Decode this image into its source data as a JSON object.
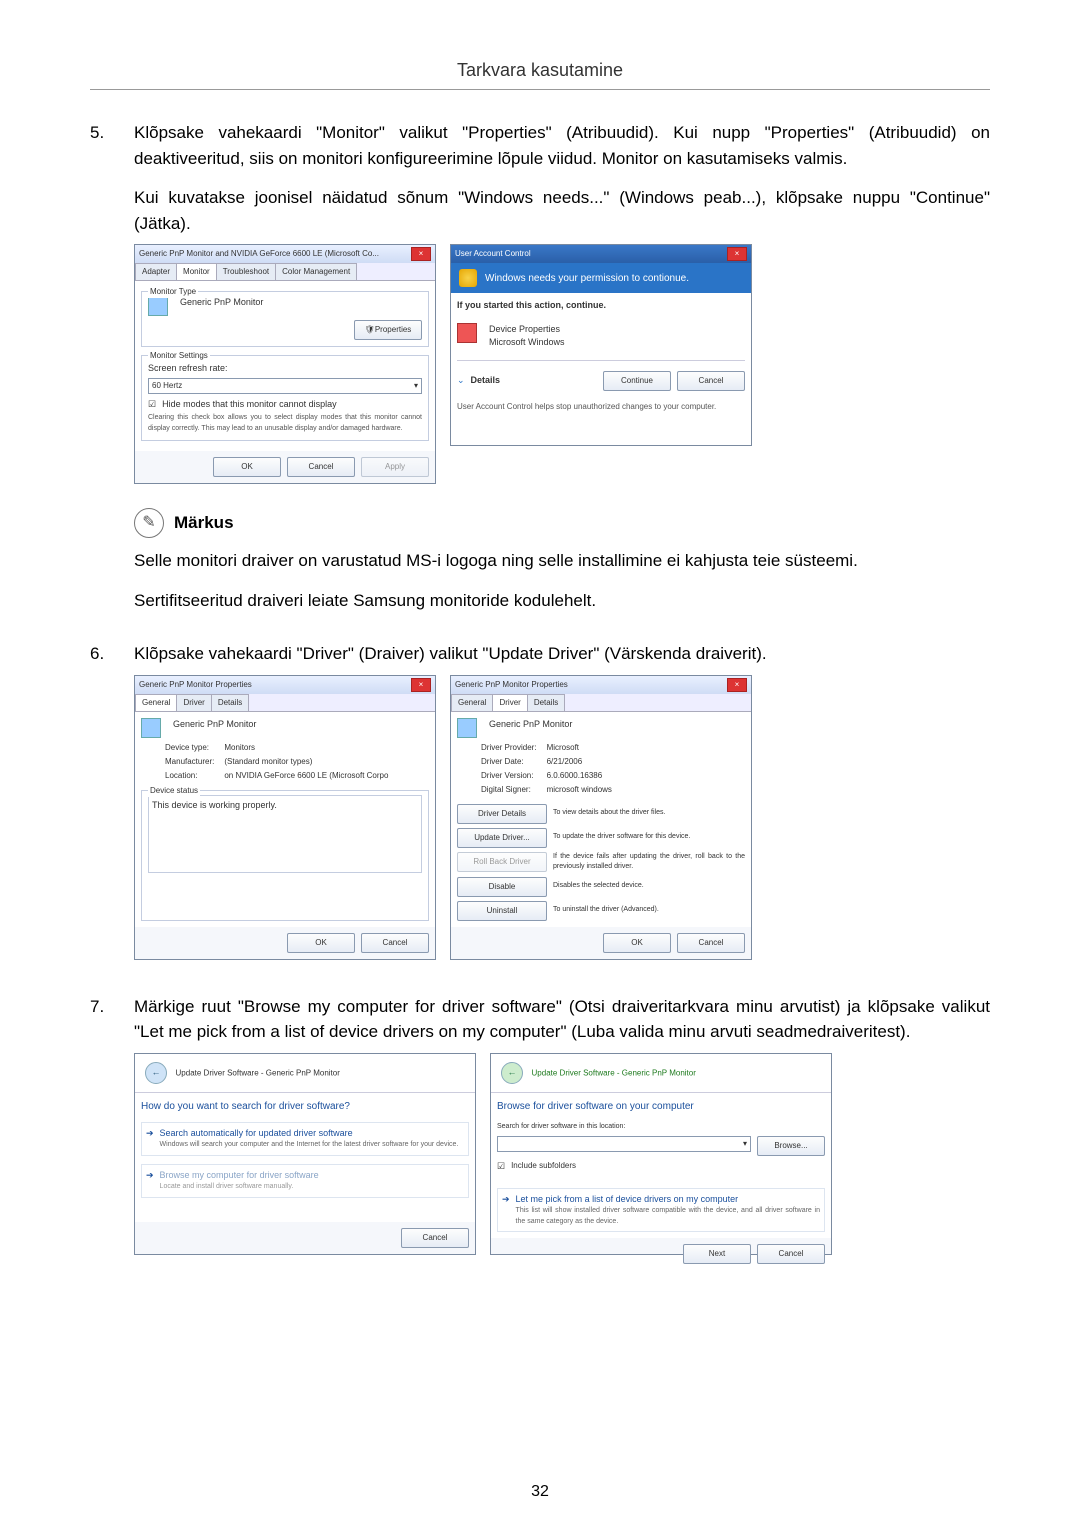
{
  "header": {
    "title": "Tarkvara kasutamine"
  },
  "steps": {
    "s5": {
      "num": "5.",
      "text1": "Klõpsake vahekaardi \"Monitor\" valikut \"Properties\" (Atribuudid). Kui nupp \"Properties\" (Atribuudid) on deaktiveeritud, siis on monitori konfigureerimine lõpule viidud. Monitor on kasutamiseks valmis.",
      "text2": "Kui kuvatakse joonisel näidatud sõnum \"Windows needs...\" (Windows peab...), klõpsake nuppu \"Continue\" (Jätka)."
    },
    "s6": {
      "num": "6.",
      "text": "Klõpsake vahekaardi \"Driver\" (Draiver) valikut \"Update Driver\" (Värskenda draiverit)."
    },
    "s7": {
      "num": "7.",
      "text": "Märkige ruut \"Browse my computer for driver software\" (Otsi draiveritarkvara minu arvutist) ja klõpsake valikut \"Let me pick from a list of device drivers on my computer\" (Luba valida minu arvuti seadmedraiveritest)."
    }
  },
  "note": {
    "label": "Märkus",
    "body1": "Selle monitori draiver on varustatud MS-i logoga ning selle installimine ei kahjusta teie süsteemi.",
    "body2": "Sertifitseeritud draiveri leiate Samsung monitoride kodulehelt."
  },
  "fig1": {
    "left": {
      "title": "Generic PnP Monitor and NVIDIA GeForce 6600 LE (Microsoft Co...",
      "tabs": [
        "Adapter",
        "Monitor",
        "Troubleshoot",
        "Color Management"
      ],
      "monitor_type_lbl": "Monitor Type",
      "monitor_type_val": "Generic PnP Monitor",
      "properties_btn": "Properties",
      "settings_lbl": "Monitor Settings",
      "refresh_lbl": "Screen refresh rate:",
      "refresh_val": "60 Hertz",
      "hide_chk": "Hide modes that this monitor cannot display",
      "hide_desc": "Clearing this check box allows you to select display modes that this monitor cannot display correctly. This may lead to an unusable display and/or damaged hardware.",
      "ok": "OK",
      "cancel": "Cancel",
      "apply": "Apply"
    },
    "right": {
      "title": "User Account Control",
      "banner": "Windows needs your permission to contionue.",
      "started": "If you started this action, continue.",
      "dev_prop": "Device Properties",
      "ms_win": "Microsoft Windows",
      "details": "Details",
      "continue": "Continue",
      "cancel": "Cancel",
      "footer": "User Account Control helps stop unauthorized changes to your computer."
    }
  },
  "fig2": {
    "left": {
      "title": "Generic PnP Monitor Properties",
      "tabs": [
        "General",
        "Driver",
        "Details"
      ],
      "pane_title": "Generic PnP Monitor",
      "devtype_k": "Device type:",
      "devtype_v": "Monitors",
      "manu_k": "Manufacturer:",
      "manu_v": "(Standard monitor types)",
      "loc_k": "Location:",
      "loc_v": "on NVIDIA GeForce 6600 LE (Microsoft Corpo",
      "status_lbl": "Device status",
      "status_val": "This device is working properly.",
      "ok": "OK",
      "cancel": "Cancel"
    },
    "right": {
      "title": "Generic PnP Monitor Properties",
      "tabs": [
        "General",
        "Driver",
        "Details"
      ],
      "pane_title": "Generic PnP Monitor",
      "provider_k": "Driver Provider:",
      "provider_v": "Microsoft",
      "date_k": "Driver Date:",
      "date_v": "6/21/2006",
      "ver_k": "Driver Version:",
      "ver_v": "6.0.6000.16386",
      "signer_k": "Digital Signer:",
      "signer_v": "microsoft windows",
      "btns": {
        "details": "Driver Details",
        "details_d": "To view details about the driver files.",
        "update": "Update Driver...",
        "update_d": "To update the driver software for this device.",
        "rollback": "Roll Back Driver",
        "rollback_d": "If the device fails after updating the driver, roll back to the previously installed driver.",
        "disable": "Disable",
        "disable_d": "Disables the selected device.",
        "uninstall": "Uninstall",
        "uninstall_d": "To uninstall the driver (Advanced)."
      },
      "ok": "OK",
      "cancel": "Cancel"
    }
  },
  "fig3": {
    "left": {
      "crumb": "Update Driver Software - Generic PnP Monitor",
      "heading": "How do you want to search for driver software?",
      "opt1": "Search automatically for updated driver software",
      "opt1_d": "Windows will search your computer and the Internet for the latest driver software for your device.",
      "opt2": "Browse my computer for driver software",
      "opt2_d": "Locate and install driver software manually.",
      "cancel": "Cancel"
    },
    "right": {
      "crumb": "Update Driver Software - Generic PnP Monitor",
      "heading": "Browse for driver software on your computer",
      "loc_lbl": "Search for driver software in this location:",
      "browse": "Browse...",
      "include": "Include subfolders",
      "opt": "Let me pick from a list of device drivers on my computer",
      "opt_d": "This list will show installed driver software compatible with the device, and all driver software in the same category as the device.",
      "next": "Next",
      "cancel": "Cancel"
    }
  },
  "page_number": "32"
}
